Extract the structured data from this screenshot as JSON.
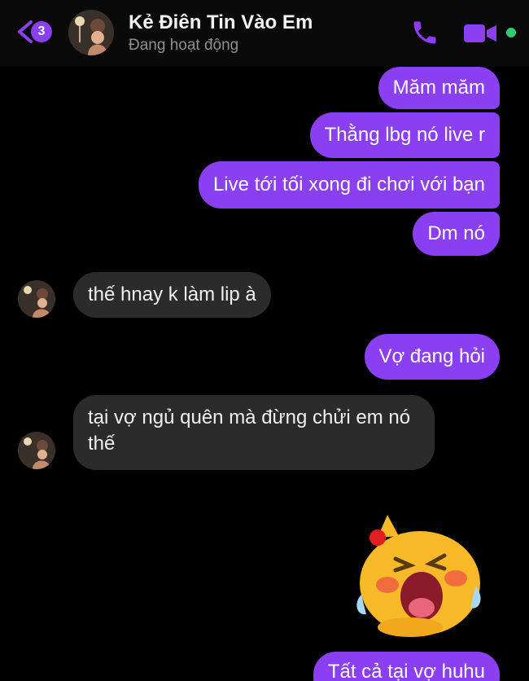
{
  "header": {
    "unread_count": "3",
    "contact_name": "Kẻ Điên Tin Vào Em",
    "status": "Đang hoạt động"
  },
  "messages": [
    {
      "side": "sent",
      "text": "Măm măm"
    },
    {
      "side": "sent",
      "text": "Thằng lbg nó live r"
    },
    {
      "side": "sent",
      "text": "Live tới tối xong đi chơi với bạn"
    },
    {
      "side": "sent",
      "text": "Dm nó"
    },
    {
      "side": "received",
      "text": "thế hnay k làm lip à"
    },
    {
      "side": "sent",
      "text": "Vợ đang hỏi"
    },
    {
      "side": "received",
      "text": "tại vợ ngủ quên mà đừng chửi em nó thế"
    },
    {
      "side": "sent",
      "text": "Tất cả tại vợ huhu"
    }
  ],
  "colors": {
    "sent_bubble": "#8b3ff3",
    "received_bubble": "#2b2b2b",
    "accent": "#8a3ff0",
    "online": "#2ecc71"
  }
}
